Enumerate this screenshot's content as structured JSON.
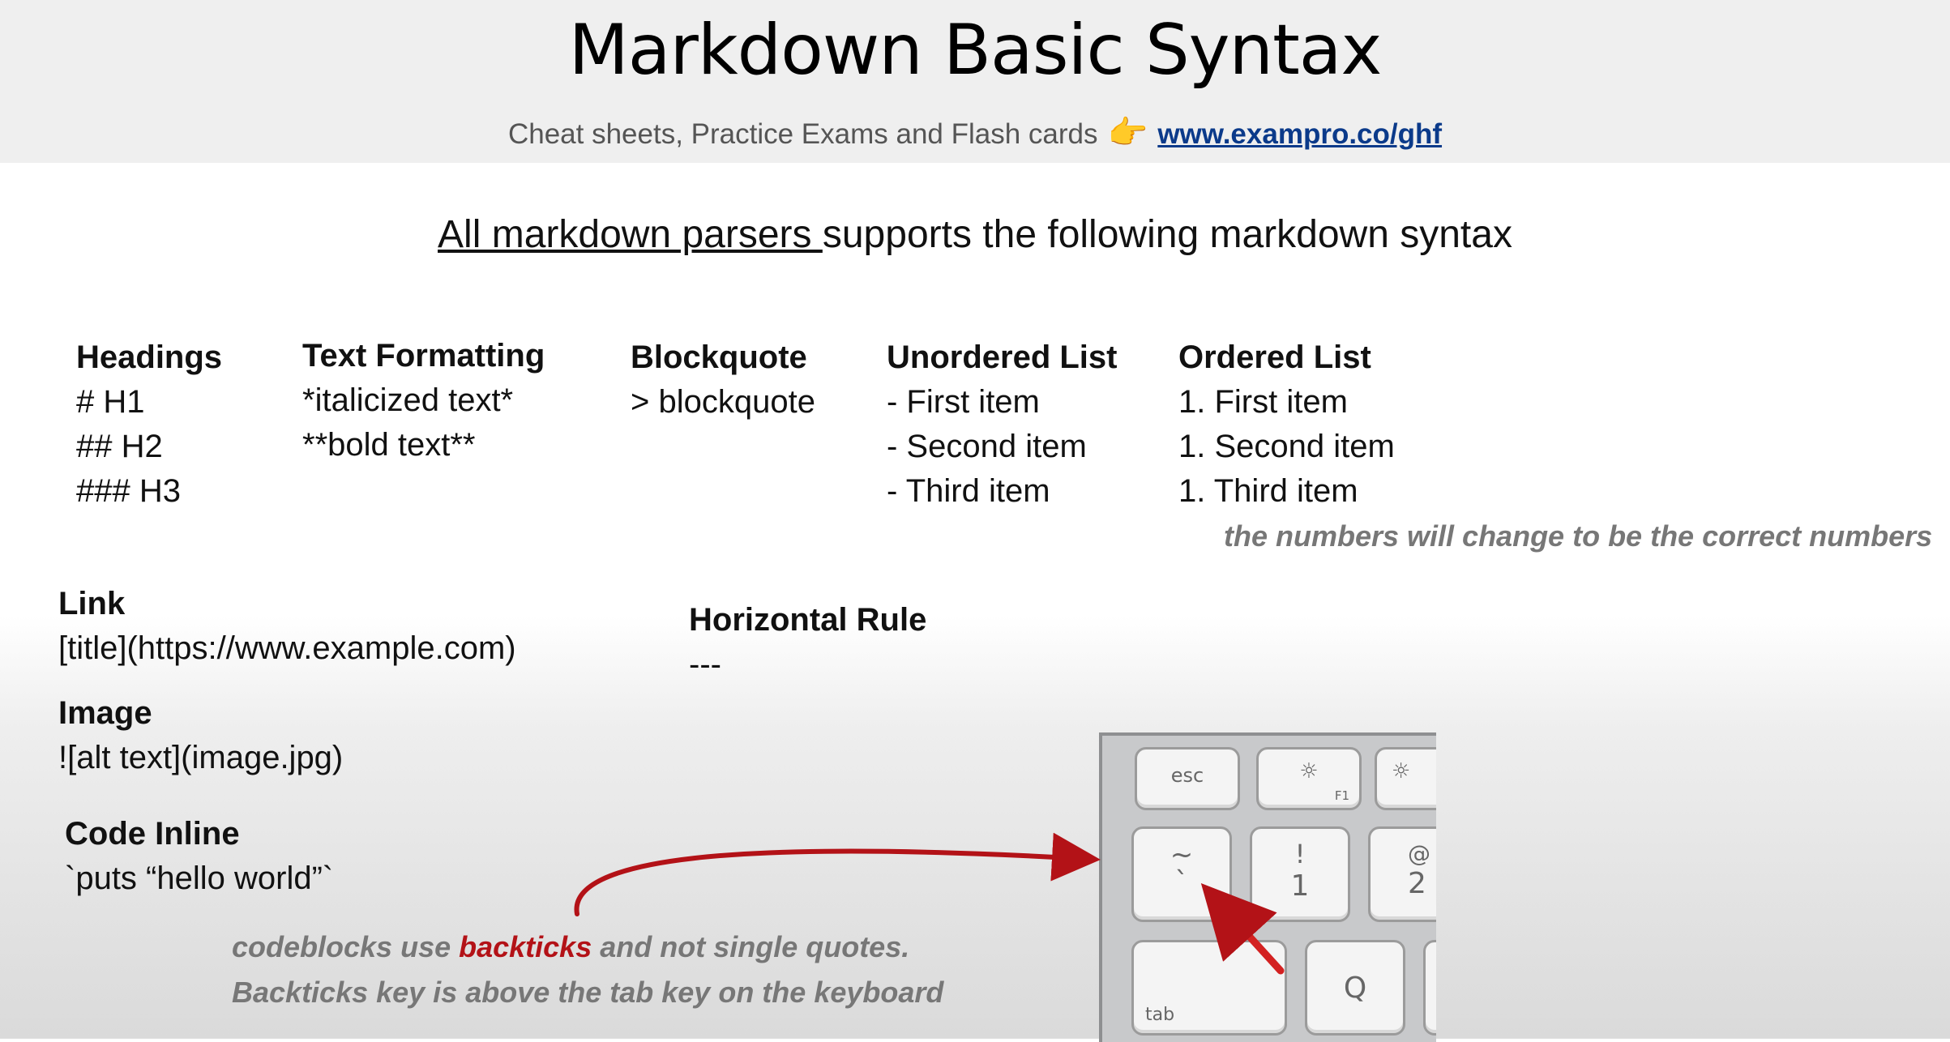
{
  "header": {
    "title": "Markdown Basic Syntax",
    "subtitle_text": "Cheat sheets, Practice Exams and Flash cards",
    "hand_icon": "👉",
    "link_text": "www.exampro.co/ghf"
  },
  "intro": {
    "underlined": "All markdown parsers ",
    "rest": "supports the following markdown syntax"
  },
  "columns": {
    "headings": {
      "title": "Headings",
      "lines": [
        "# H1",
        "## H2",
        "### H3"
      ]
    },
    "text_formatting": {
      "title": "Text Formatting",
      "lines": [
        "*italicized text*",
        "**bold text**"
      ]
    },
    "blockquote": {
      "title": "Blockquote",
      "lines": [
        "> blockquote"
      ]
    },
    "unordered": {
      "title": "Unordered List",
      "lines": [
        "- First item",
        "- Second item",
        "- Third item"
      ]
    },
    "ordered": {
      "title": "Ordered List",
      "lines": [
        "1. First item",
        "1. Second item",
        "1. Third item"
      ]
    }
  },
  "ordered_note": "the numbers will change to be the correct numbers",
  "link": {
    "title": "Link",
    "syntax": "[title](https://www.example.com)"
  },
  "horizontal_rule": {
    "title": "Horizontal Rule",
    "syntax": "---"
  },
  "image": {
    "title": "Image",
    "syntax": "![alt text](image.jpg)"
  },
  "code_inline": {
    "title": "Code Inline",
    "syntax": "`puts “hello world”`"
  },
  "backtick_note": {
    "line1_pre": "codeblocks use ",
    "line1_em": "backticks",
    "line1_post": " and not single quotes.",
    "line2": "Backticks key is above the tab key on the keyboard"
  },
  "keyboard": {
    "esc": "esc",
    "f1_label": "F1",
    "tilde_top": "~",
    "tilde_bottom": "`",
    "one_top": "!",
    "one_bottom": "1",
    "two_top": "@",
    "two_bottom": "2",
    "tab": "tab",
    "q": "Q"
  },
  "colors": {
    "arrow": "#b31217",
    "highlight": "#b31217",
    "note": "#777777",
    "link": "#0b3a8a"
  }
}
